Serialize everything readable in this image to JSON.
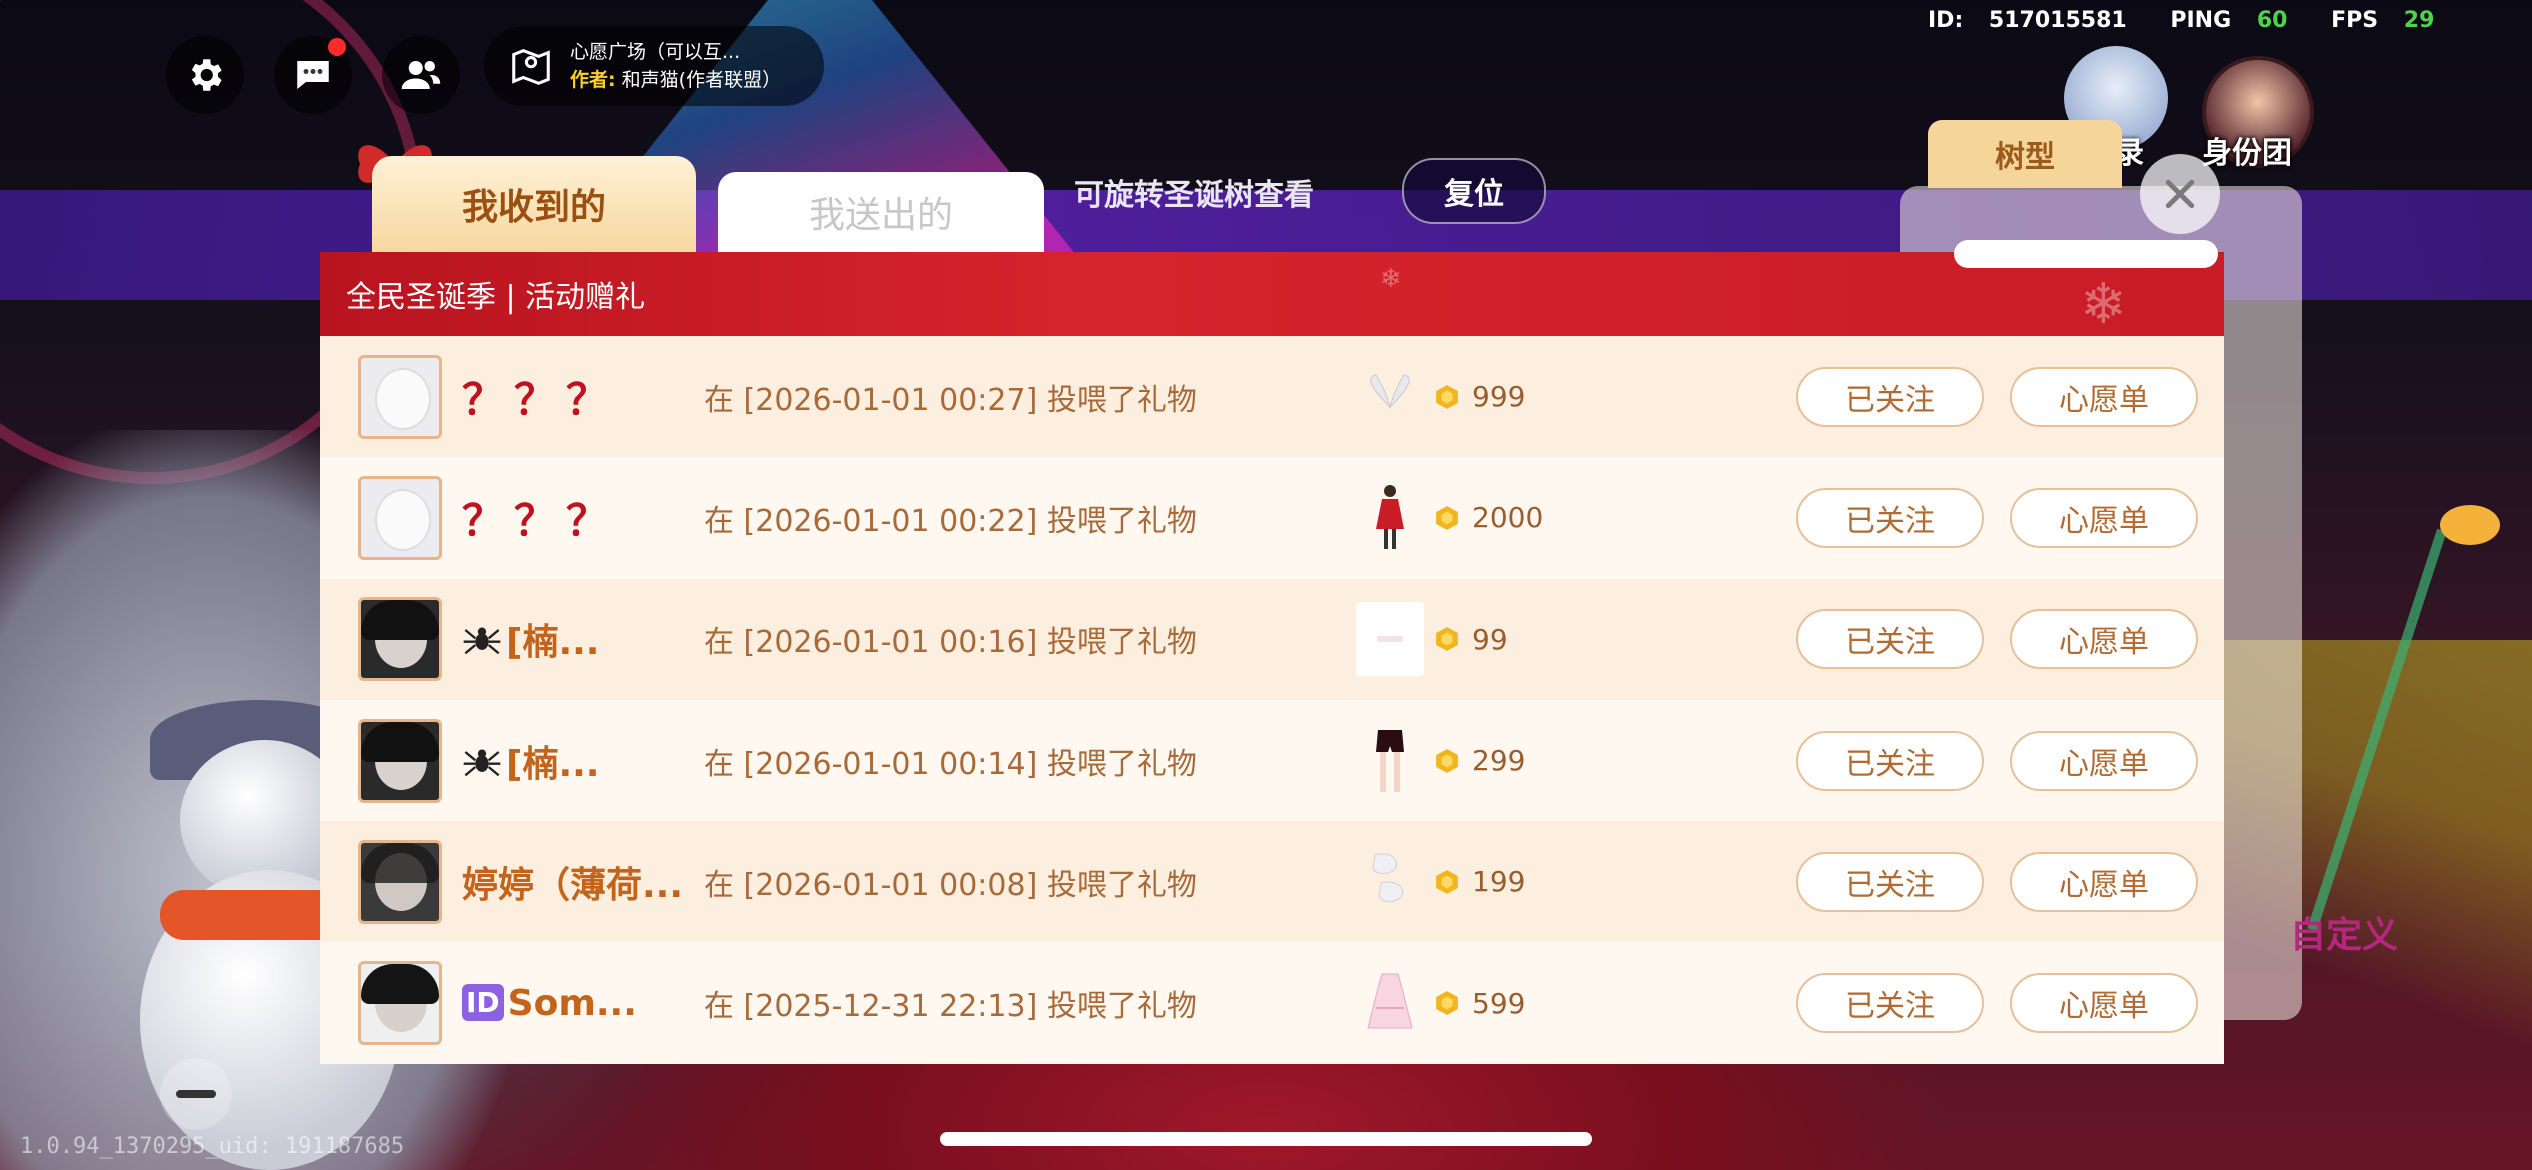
{
  "hud": {
    "location_line1": "心愿广场（可以互...",
    "author_key": "作者:",
    "author_value": "和声猫(作者联盟）",
    "stats": {
      "id_label": "ID:",
      "id": "517015581",
      "ping_label": "PING",
      "ping": "60",
      "fps_label": "FPS",
      "fps": "29"
    },
    "right_label": "身份团",
    "right_label_partial": "录",
    "version": "1.0.94_1370295_uid: 191187685"
  },
  "tabs": {
    "received": "我收到的",
    "sent": "我送出的",
    "rotate_hint": "可旋转圣诞树查看",
    "reset": "复位"
  },
  "side": {
    "tree_tab": "树型",
    "custom": "自定义"
  },
  "panel": {
    "title": "全民圣诞季 | 活动赠礼",
    "follow_label": "已关注",
    "wish_label": "心愿单",
    "rows": [
      {
        "name": "？？？",
        "message": "在 [2026-01-01 00:27] 投喂了礼物",
        "price": "999",
        "gift": "wings-icon"
      },
      {
        "name": "？？？",
        "message": "在 [2026-01-01 00:22] 投喂了礼物",
        "price": "2000",
        "gift": "red-dress-icon"
      },
      {
        "name": "[楠...",
        "message": "在 [2026-01-01 00:16] 投喂了礼物",
        "price": "99",
        "gift": "tag-icon"
      },
      {
        "name": "[楠...",
        "message": "在 [2026-01-01 00:14] 投喂了礼物",
        "price": "299",
        "gift": "shorts-icon"
      },
      {
        "name": "婷婷（薄荷...",
        "message": "在 [2026-01-01 00:08] 投喂了礼物",
        "price": "199",
        "gift": "gloves-icon"
      },
      {
        "name": "Som...",
        "message": "在 [2025-12-31 22:13] 投喂了礼物",
        "price": "599",
        "gift": "pink-dress-icon"
      }
    ]
  },
  "colors": {
    "header_red": "#c81c26",
    "question_red": "#c0121e",
    "name_orange": "#c4641b",
    "tab_gold": "#f6d79f"
  }
}
